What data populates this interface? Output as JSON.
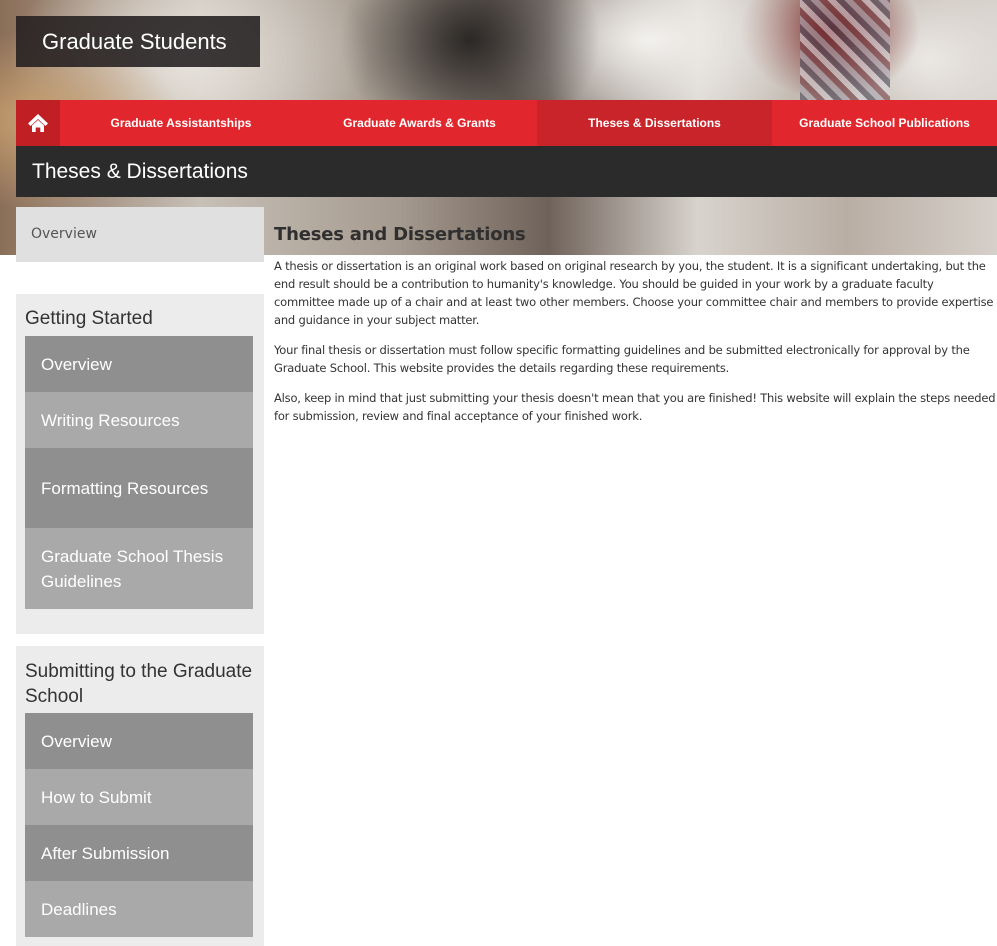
{
  "site": {
    "title": "Graduate Students"
  },
  "nav": {
    "home_icon": "home-icon",
    "items": [
      {
        "label": "Graduate Assistantships"
      },
      {
        "label": "Graduate Awards & Grants"
      },
      {
        "label": "Theses & Dissertations",
        "active": true
      },
      {
        "label": "Graduate School Publications"
      }
    ]
  },
  "section": {
    "title": "Theses & Dissertations"
  },
  "sidebar": {
    "overview": "Overview",
    "groups": [
      {
        "heading": "Getting Started",
        "links": [
          "Overview",
          "Writing Resources",
          "Formatting Resources",
          "Graduate School Thesis Guidelines"
        ]
      },
      {
        "heading": "Submitting to the Graduate School",
        "links": [
          "Overview",
          "How to Submit",
          "After Submission",
          "Deadlines"
        ]
      }
    ]
  },
  "main": {
    "heading": "Theses and Dissertations",
    "paragraphs": [
      "A thesis or dissertation is an original work based on original research by you, the student. It is a significant undertaking, but the end result should be a contribution to humanity's knowledge. You should be guided in your work by a graduate faculty committee made up of a chair and at least two other members. Choose your committee chair and members to provide expertise and guidance in your subject matter.",
      "Your final thesis or dissertation must follow specific formatting guidelines and be submitted electronically for approval by the Graduate School. This website provides the details regarding these requirements.",
      "Also, keep in mind that just submitting your thesis doesn't mean that you are finished! This website will explain the steps needed for submission, review and final acceptance of your finished work."
    ]
  },
  "colors": {
    "nav_red": "#e1272d",
    "nav_active": "#c8242a",
    "section_bar": "#2b2b2b",
    "sidebar_dark": "#8f8f8f",
    "sidebar_light": "#a9a9a9"
  }
}
